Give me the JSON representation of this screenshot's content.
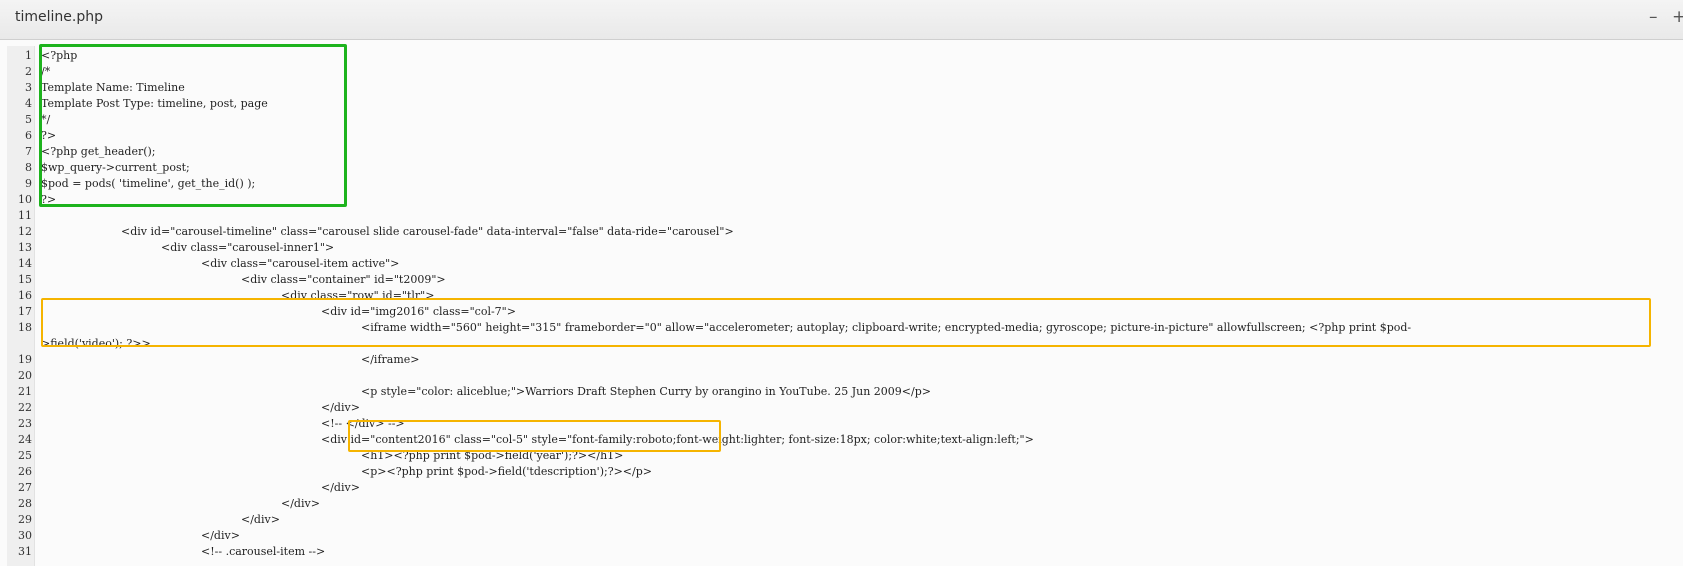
{
  "window": {
    "title": "timeline.php",
    "minimize_glyph": "–",
    "maximize_glyph": "+"
  },
  "editor": {
    "lines": [
      {
        "n": "1",
        "indent": 0,
        "text": "<?php"
      },
      {
        "n": "2",
        "indent": 0,
        "text": "/*"
      },
      {
        "n": "3",
        "indent": 0,
        "text": "Template Name: Timeline"
      },
      {
        "n": "4",
        "indent": 0,
        "text": "Template Post Type: timeline, post, page"
      },
      {
        "n": "5",
        "indent": 0,
        "text": "*/"
      },
      {
        "n": "6",
        "indent": 0,
        "text": "?>"
      },
      {
        "n": "7",
        "indent": 0,
        "text": "<?php get_header();"
      },
      {
        "n": "8",
        "indent": 0,
        "text": "$wp_query->current_post;"
      },
      {
        "n": "9",
        "indent": 0,
        "text": "$pod = pods( 'timeline', get_the_id() );"
      },
      {
        "n": "10",
        "indent": 0,
        "text": "?>"
      },
      {
        "n": "11",
        "indent": 0,
        "text": ""
      },
      {
        "n": "12",
        "indent": 2,
        "text": "<div id=\"carousel-timeline\" class=\"carousel slide carousel-fade\" data-interval=\"false\" data-ride=\"carousel\">"
      },
      {
        "n": "13",
        "indent": 3,
        "text": "<div class=\"carousel-inner1\">"
      },
      {
        "n": "14",
        "indent": 4,
        "text": "<div class=\"carousel-item active\">"
      },
      {
        "n": "15",
        "indent": 5,
        "text": "<div class=\"container\" id=\"t2009\">"
      },
      {
        "n": "16",
        "indent": 6,
        "text": "<div class=\"row\" id=\"tlr\">"
      },
      {
        "n": "17",
        "indent": 7,
        "text": "<div id=\"img2016\" class=\"col-7\">"
      },
      {
        "n": "18",
        "indent": 8,
        "text": "<iframe width=\"560\" height=\"315\" frameborder=\"0\" allow=\"accelerometer; autoplay; clipboard-write; encrypted-media; gyroscope; picture-in-picture\" allowfullscreen; <?php print $pod-"
      },
      {
        "n": "",
        "indent": 0,
        "text": ">field('video'); ?>>"
      },
      {
        "n": "19",
        "indent": 8,
        "text": "</iframe>"
      },
      {
        "n": "20",
        "indent": 0,
        "text": ""
      },
      {
        "n": "21",
        "indent": 8,
        "text": "<p style=\"color: aliceblue;\">Warriors Draft Stephen Curry by orangino in YouTube. 25 Jun 2009</p>"
      },
      {
        "n": "22",
        "indent": 7,
        "text": "</div>"
      },
      {
        "n": "23",
        "indent": 7,
        "text": "<!-- </div> -->"
      },
      {
        "n": "24",
        "indent": 7,
        "text": "<div id=\"content2016\" class=\"col-5\" style=\"font-family:roboto;font-weight:lighter; font-size:18px; color:white;text-align:left;\">"
      },
      {
        "n": "25",
        "indent": 8,
        "text": "<h1><?php print $pod->field('year');?></h1>"
      },
      {
        "n": "26",
        "indent": 8,
        "text": "<p><?php print $pod->field('tdescription');?></p>"
      },
      {
        "n": "27",
        "indent": 7,
        "text": "</div>"
      },
      {
        "n": "28",
        "indent": 6,
        "text": "</div>"
      },
      {
        "n": "29",
        "indent": 5,
        "text": "</div>"
      },
      {
        "n": "30",
        "indent": 4,
        "text": "</div>"
      },
      {
        "n": "31",
        "indent": 4,
        "text": "<!-- .carousel-item -->"
      }
    ]
  },
  "colors": {
    "header_highlight": "#1db31d",
    "field_highlight": "#f5b400"
  }
}
